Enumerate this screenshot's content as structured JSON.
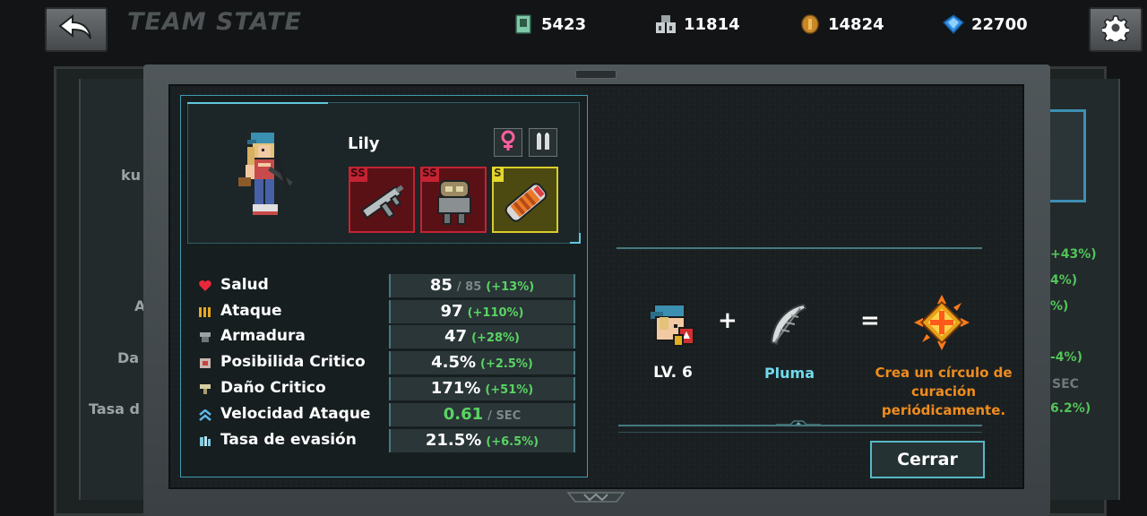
{
  "header": {
    "title": "TEAM STATE",
    "currencies": [
      {
        "icon": "card-icon",
        "value": "5423"
      },
      {
        "icon": "ammo-crate-icon",
        "value": "11814"
      },
      {
        "icon": "coin-icon",
        "value": "14824"
      },
      {
        "icon": "gem-icon",
        "value": "22700"
      }
    ]
  },
  "background": {
    "left_fragments": [
      "ku",
      "A",
      "Da",
      "Tasa d"
    ],
    "right_fragments": [
      "+43%)",
      "4%)",
      "%)",
      "-4%)",
      "SEC",
      "6.2%)"
    ]
  },
  "character": {
    "name": "Lily",
    "gender_icon": "female-icon",
    "type_icon": "bullets-icon",
    "equipment": [
      {
        "grade": "SS",
        "item": "submachine-gun",
        "color": "#c32333"
      },
      {
        "grade": "SS",
        "item": "robot-helmet",
        "color": "#c32333"
      },
      {
        "grade": "S",
        "item": "grenade-capsule",
        "color": "#d9cc29"
      }
    ]
  },
  "stats": [
    {
      "icon": "heart-icon",
      "label": "Salud",
      "value": "85",
      "sub": "/ 85",
      "bonus": "(+13%)"
    },
    {
      "icon": "attack-bars-icon",
      "label": "Ataque",
      "value": "97",
      "sub": "",
      "bonus": "(+110%)"
    },
    {
      "icon": "armor-icon",
      "label": "Armadura",
      "value": "47",
      "sub": "",
      "bonus": "(+28%)"
    },
    {
      "icon": "crit-chance-icon",
      "label": "Posibilida Critico",
      "value": "4.5%",
      "sub": "",
      "bonus": "(+2.5%)"
    },
    {
      "icon": "crit-damage-icon",
      "label": "Daño Critico",
      "value": "171%",
      "sub": "",
      "bonus": "(+51%)"
    },
    {
      "icon": "attack-speed-icon",
      "label": "Velocidad Ataque",
      "value": "0.61",
      "sub": "/ SEC",
      "bonus": ""
    },
    {
      "icon": "evasion-icon",
      "label": "Tasa de evasión",
      "value": "21.5%",
      "sub": "",
      "bonus": "(+6.5%)"
    }
  ],
  "skill": {
    "level": "LV. 6",
    "plus": "+",
    "equals": "=",
    "material": "Pluma",
    "description": "Crea un círculo de curación periódicamente.",
    "highlight_color": "#f08c1e"
  },
  "close_label": "Cerrar"
}
